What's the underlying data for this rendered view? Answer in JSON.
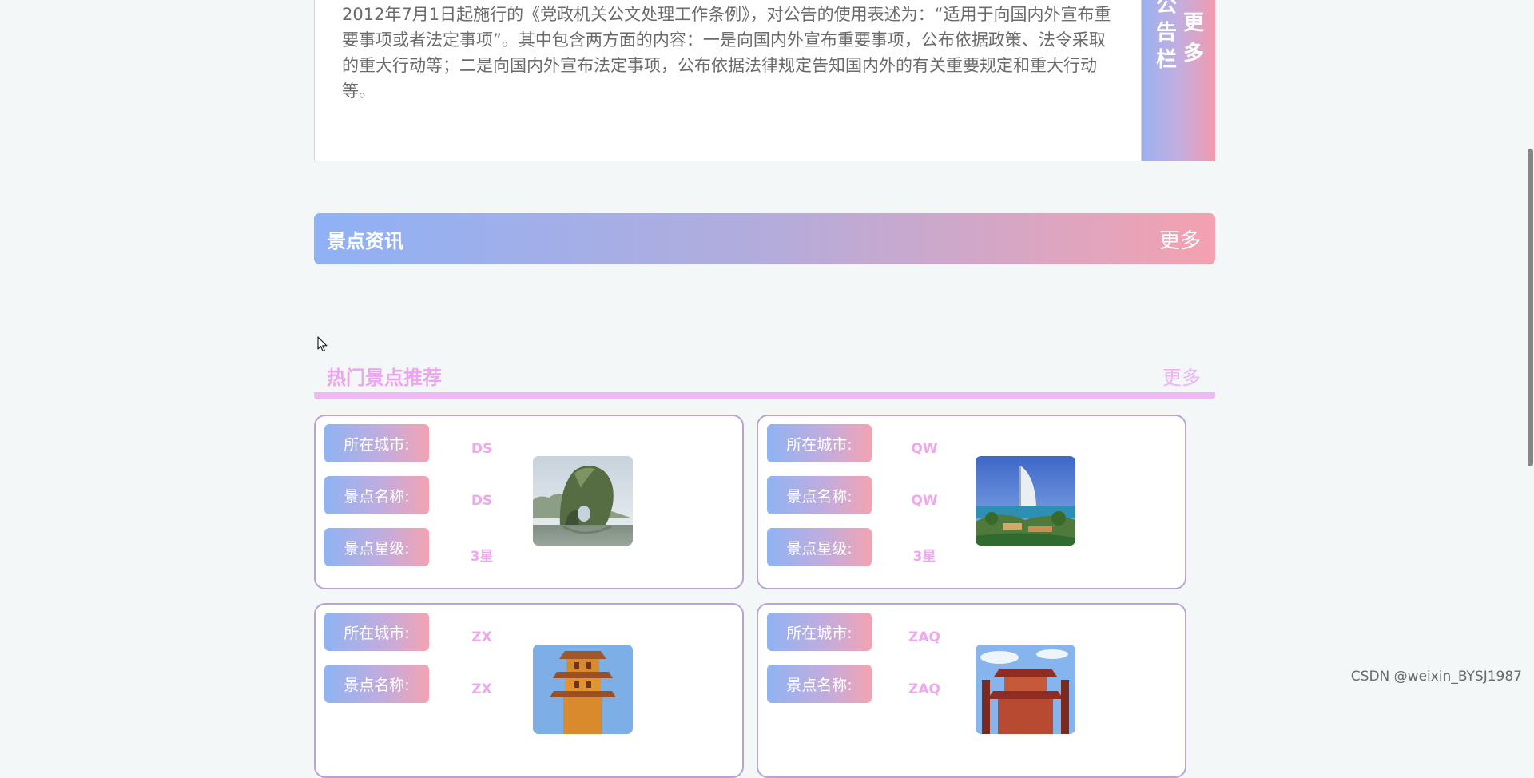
{
  "notice": {
    "text": "2012年7月1日起施行的《党政机关公文处理工作条例》，对公告的使用表述为：“适用于向国内外宣布重要事项或者法定事项”。其中包含两方面的内容：一是向国内外宣布重要事项，公布依据政策、法令采取的重大行动等；二是向国内外宣布法定事项，公布依据法律规定告知国内外的有关重要规定和重大行动等。",
    "side_title": "公告栏",
    "more_label": "更多"
  },
  "news_section": {
    "title": "景点资讯",
    "more_label": "更多"
  },
  "hot_section": {
    "title": "热门景点推荐",
    "more_label": "更多"
  },
  "labels": {
    "city": "所在城市:",
    "name": "景点名称:",
    "level": "景点星级:"
  },
  "cards": [
    {
      "city": "DS",
      "name": "DS",
      "level": "3星",
      "image": "elephant-trunk-hill"
    },
    {
      "city": "QW",
      "name": "QW",
      "level": "3星",
      "image": "burj-al-arab"
    },
    {
      "city": "ZX",
      "name": "ZX",
      "image": "yellow-crane-tower"
    },
    {
      "city": "ZAQ",
      "name": "ZAQ",
      "image": "pagoda-building"
    }
  ],
  "watermark": "CSDN @weixin_BYSJ1987",
  "colors": {
    "page_bg": "#f3f7f8",
    "gradient_start": "#8fb1f6",
    "gradient_end": "#f4a1b0",
    "pink_text": "#efa8ee",
    "card_border": "#b9a2d8"
  }
}
